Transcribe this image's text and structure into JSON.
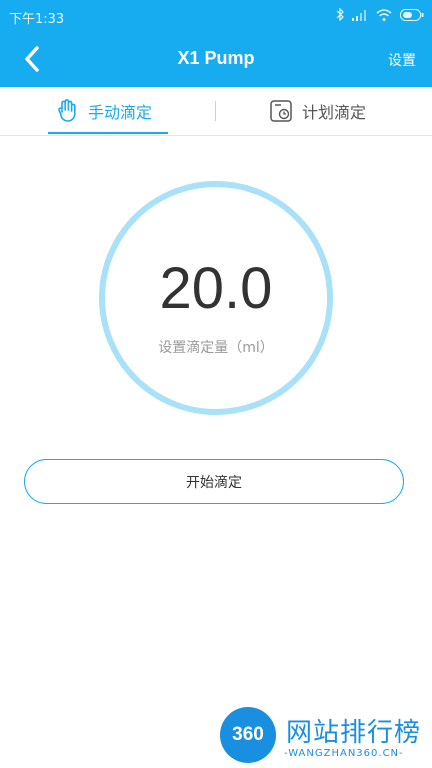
{
  "status_bar": {
    "time": "下午1:33",
    "icons": [
      "bluetooth-icon",
      "signal-icon",
      "wifi-icon",
      "battery-icon"
    ]
  },
  "app_bar": {
    "title": "X1 Pump",
    "settings_label": "设置",
    "back_icon": "chevron-left-icon"
  },
  "tabs": [
    {
      "label": "手动滴定",
      "icon": "hand-icon",
      "active": true
    },
    {
      "label": "计划滴定",
      "icon": "schedule-icon",
      "active": false
    }
  ],
  "dial": {
    "value": "20.0",
    "label": "设置滴定量（ml）"
  },
  "actions": {
    "start_label": "开始滴定"
  },
  "watermark": {
    "logo": "360",
    "title": "网站排行榜",
    "subtitle": "-WANGZHAN360.CN-"
  },
  "colors": {
    "primary": "#17abef",
    "ring": "#a8e1f8",
    "text": "#333333"
  }
}
